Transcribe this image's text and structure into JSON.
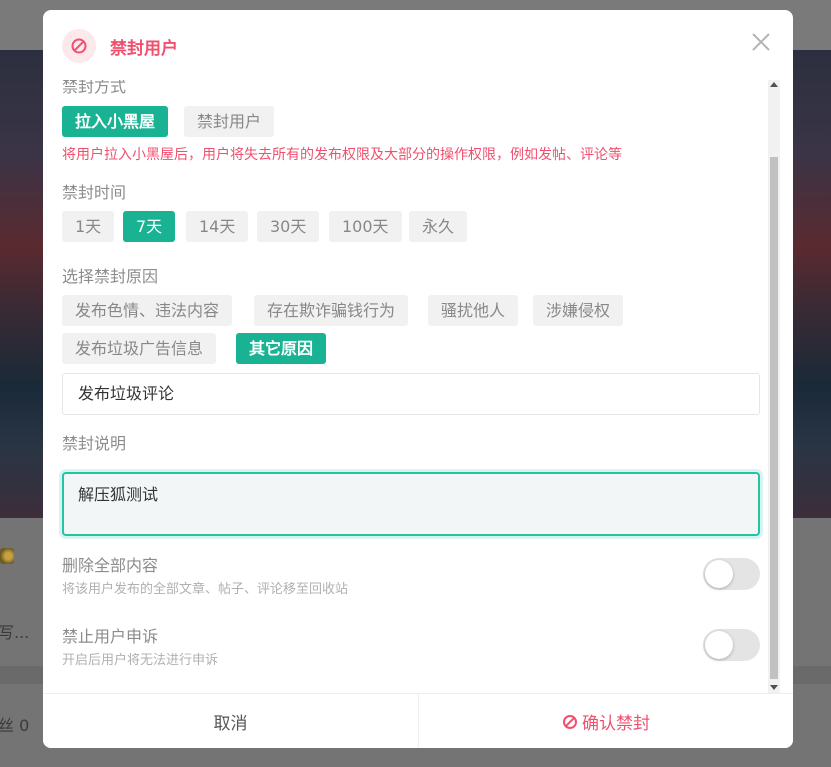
{
  "background": {
    "side_text_1": "写...",
    "side_text_2": "丝 0"
  },
  "modal": {
    "title": "禁封用户",
    "title_icon": "ban-icon",
    "close_icon": "close-icon"
  },
  "ban_method": {
    "label": "禁封方式",
    "options": [
      "拉入小黑屋",
      "禁封用户"
    ],
    "selected": "拉入小黑屋",
    "hint": "将用户拉入小黑屋后，用户将失去所有的发布权限及大部分的操作权限，例如发帖、评论等"
  },
  "ban_duration": {
    "label": "禁封时间",
    "options": [
      "1天",
      "7天",
      "14天",
      "30天",
      "100天",
      "永久"
    ],
    "selected": "7天"
  },
  "ban_reason": {
    "label": "选择禁封原因",
    "options": [
      "发布色情、违法内容",
      "存在欺诈骗钱行为",
      "骚扰他人",
      "涉嫌侵权",
      "发布垃圾广告信息",
      "其它原因"
    ],
    "selected": "其它原因",
    "custom_value": "发布垃圾评论"
  },
  "ban_description": {
    "label": "禁封说明",
    "value": "解压狐测试"
  },
  "delete_all": {
    "title": "删除全部内容",
    "subtitle": "将该用户发布的全部文章、帖子、评论移至回收站",
    "enabled": false
  },
  "forbid_appeal": {
    "title": "禁止用户申诉",
    "subtitle": "开启后用户将无法进行申诉",
    "enabled": false
  },
  "footer": {
    "cancel_label": "取消",
    "confirm_label": "确认禁封"
  },
  "colors": {
    "accent": "#19b394",
    "danger": "#f0506e"
  }
}
